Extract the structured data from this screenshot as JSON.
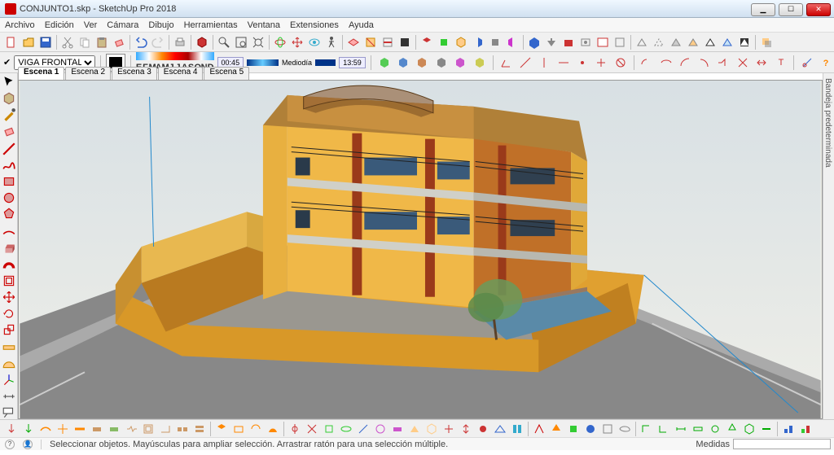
{
  "window": {
    "title": "CONJUNTO1.skp - SketchUp Pro 2018"
  },
  "menu": {
    "items": [
      "Archivo",
      "Edición",
      "Ver",
      "Cámara",
      "Dibujo",
      "Herramientas",
      "Ventana",
      "Extensiones",
      "Ayuda"
    ]
  },
  "layer": {
    "current": "VIGA FRONTAL"
  },
  "shadow": {
    "months": [
      "E",
      "F",
      "M",
      "A",
      "M",
      "J",
      "J",
      "A",
      "S",
      "O",
      "N",
      "D"
    ],
    "time": "00:45",
    "daypart": "Mediodía",
    "clock": "13:59"
  },
  "scenes": {
    "tabs": [
      "Escena 1",
      "Escena 2",
      "Escena 3",
      "Escena 4",
      "Escena 5"
    ],
    "active": 0
  },
  "tray": {
    "label": "Bandeja predeterminada"
  },
  "status": {
    "hint": "Seleccionar objetos. Mayúsculas para ampliar selección. Arrastrar ratón para una selección múltiple.",
    "measure_label": "Medidas"
  },
  "winbtns": {
    "min": "▁",
    "max": "☐",
    "close": "✕"
  }
}
